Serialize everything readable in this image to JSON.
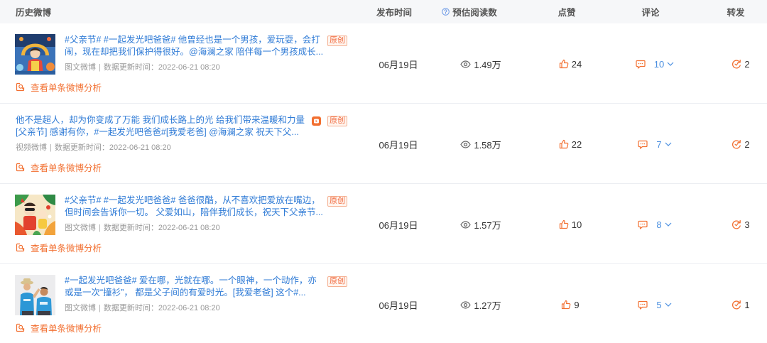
{
  "header": {
    "post": "历史微博",
    "publish_time": "发布时间",
    "est_reads": "预估阅读数",
    "likes": "点赞",
    "comments": "评论",
    "reposts": "转发"
  },
  "labels": {
    "meta_separator": "|",
    "update_label": "数据更新时间：",
    "analysis_link": "查看单条微博分析"
  },
  "posts": [
    {
      "text_lines": [
        "#父亲节# #一起发光吧爸爸# 他曾经也是一个男孩，爱玩耍，会打",
        "闹，现在却把我们保护得很好。@海澜之家 陪伴每一个男孩成长..."
      ],
      "badge": "原创",
      "post_type": "图文微博",
      "update_time": "2022-06-21 08:20",
      "publish_date": "06月19日",
      "est_reads": "1.49万",
      "likes": "24",
      "comments": "10",
      "reposts": "2"
    },
    {
      "text_lines": [
        "他不是超人，却为你变成了万能 我们成长路上的光 给我们带来温暖和力量",
        "[父亲节] 感谢有你，#一起发光吧爸爸#[我爱老爸] @海澜之家 祝天下父..."
      ],
      "media_icon": "video-icon",
      "badge": "原创",
      "post_type": "视频微博",
      "update_time": "2022-06-21 08:20",
      "publish_date": "06月19日",
      "est_reads": "1.58万",
      "likes": "22",
      "comments": "7",
      "reposts": "2"
    },
    {
      "text_lines": [
        "#父亲节# #一起发光吧爸爸# 爸爸很酷，从不喜欢把爱放在嘴边，",
        "但时间会告诉你一切。 父爱如山，陪伴我们成长，祝天下父亲节..."
      ],
      "badge": "原创",
      "post_type": "图文微博",
      "update_time": "2022-06-21 08:20",
      "publish_date": "06月19日",
      "est_reads": "1.57万",
      "likes": "10",
      "comments": "8",
      "reposts": "3"
    },
    {
      "text_lines": [
        "#一起发光吧爸爸# 爱在哪，光就在哪。一个眼神，一个动作，亦",
        "或是一次“撞衫”， 都是父子间的有爱时光。[我爱老爸] 这个#..."
      ],
      "badge": "原创",
      "post_type": "图文微博",
      "update_time": "2022-06-21 08:20",
      "publish_date": "06月19日",
      "est_reads": "1.27万",
      "likes": "9",
      "comments": "5",
      "reposts": "1"
    }
  ],
  "icons": {
    "reads_info": "question-circle-icon",
    "reads": "eye-icon",
    "likes": "thumbs-up-icon",
    "comments": "comment-icon",
    "comments_toggle": "chevron-down-icon",
    "reposts": "repost-icon",
    "analysis": "analysis-icon",
    "video": "video-icon"
  },
  "colors": {
    "link_blue": "#2f7bd6",
    "accent_orange": "#f26f30",
    "badge_orange": "#f0683c",
    "comment_blue": "#4a8fe0",
    "info_blue": "#6d9ae6",
    "text_dark": "#333333",
    "text_muted": "#999999",
    "header_bg": "#f6f7f9"
  }
}
